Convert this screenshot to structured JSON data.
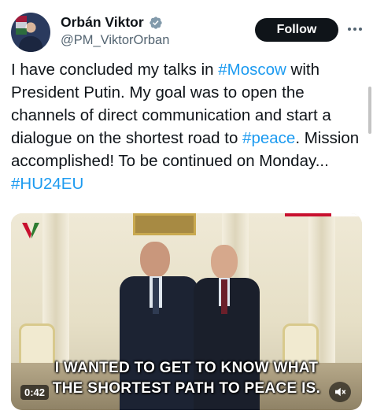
{
  "author": {
    "name": "Orbán Viktor",
    "handle": "@PM_ViktorOrban",
    "verified_icon": "verified-badge-icon"
  },
  "actions": {
    "follow_label": "Follow",
    "more_icon": "more-options-icon"
  },
  "tweet": {
    "segments": [
      {
        "text": "I have concluded my talks in ",
        "hashtag": false
      },
      {
        "text": "#Moscow",
        "hashtag": true
      },
      {
        "text": " with President Putin. My goal was to open the channels of direct communication and start a dialogue on the shortest road to ",
        "hashtag": false
      },
      {
        "text": "#peace",
        "hashtag": true
      },
      {
        "text": ". Mission accomplished! To be continued on Monday... ",
        "hashtag": false
      },
      {
        "text": "#HU24EU",
        "hashtag": true
      }
    ]
  },
  "video": {
    "caption_line1": "I WANTED TO GET TO KNOW WHAT",
    "caption_line2": "THE SHORTEST PATH TO PEACE IS.",
    "timestamp": "0:42",
    "mute_icon": "muted-speaker-icon",
    "logo_icon": "v-logo-icon"
  },
  "colors": {
    "text": "#0f1419",
    "secondary": "#536471",
    "link": "#1d9bf0",
    "verified": "#829aab",
    "follow_bg": "#0f1419"
  }
}
